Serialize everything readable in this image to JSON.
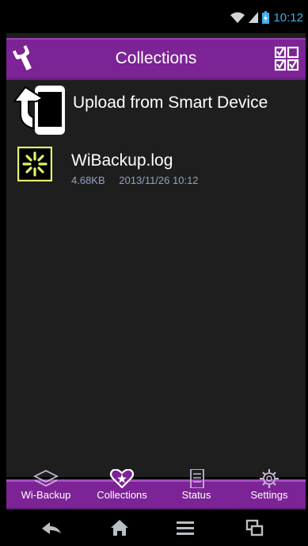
{
  "status_bar": {
    "time": "10:12",
    "icons": [
      "wifi-icon",
      "signal-icon",
      "battery-charging-icon"
    ]
  },
  "action_bar": {
    "title": "Collections",
    "left_icon": "wrench-icon",
    "right_icon": "multi-select-checkbox-icon"
  },
  "list": {
    "upload": {
      "label": "Upload from Smart Device",
      "icon": "phone-upload-icon"
    },
    "items": [
      {
        "name": "WiBackup.log",
        "size": "4.68KB",
        "date": "2013/11/26 10:12",
        "icon": "log-file-icon"
      }
    ]
  },
  "tabs": [
    {
      "label": "Wi-Backup",
      "icon": "layers-icon",
      "active": false
    },
    {
      "label": "Collections",
      "icon": "heart-star-icon",
      "active": true
    },
    {
      "label": "Status",
      "icon": "document-icon",
      "active": false
    },
    {
      "label": "Settings",
      "icon": "gear-icon",
      "active": false
    }
  ],
  "nav_bar": {
    "icons": [
      "back-icon",
      "home-icon",
      "menu-icon",
      "recent-apps-icon"
    ]
  },
  "colors": {
    "accent": "#7c2395",
    "status_blue": "#3fb0e8",
    "meta_text": "#8fa3c0",
    "highlight": "#e7ee6a"
  }
}
